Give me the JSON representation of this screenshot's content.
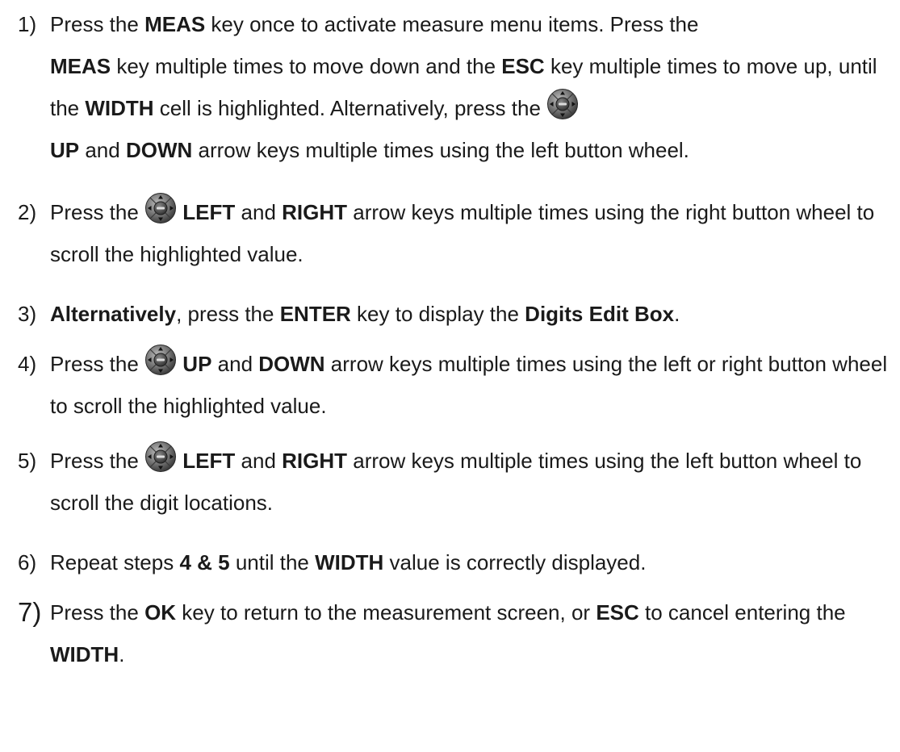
{
  "icons": {
    "wheel": "arrow-button-wheel-icon"
  },
  "steps": [
    {
      "num": "1)",
      "p1": "Press the ",
      "b1": "MEAS",
      "p2": " key once to activate measure menu items.  Press the ",
      "b2": "MEAS",
      "p3": " key multiple times to move down and the ",
      "b3": "ESC",
      "p4": " key multiple times to move up, until the ",
      "b4": "WIDTH",
      "p5": " cell is highlighted.   Alternatively, press the ",
      "b5": "UP",
      "p6": " and ",
      "b6": "DOWN",
      "p7": " arrow keys multiple times using the left button wheel."
    },
    {
      "num": "2)",
      "p1": "Press the ",
      "b1": "LEFT",
      "p2": " and ",
      "b2": "RIGHT",
      "p3": " arrow keys multiple times using the right button wheel to scroll the highlighted value."
    },
    {
      "num": "3)",
      "b1": "Alternatively",
      "p1": ", press the ",
      "b2": "ENTER",
      "p2": " key to display the ",
      "b3": "Digits Edit Box",
      "p3": "."
    },
    {
      "num": "4)",
      "p1": "Press the ",
      "b1": "UP",
      "p2": " and ",
      "b2": "DOWN",
      "p3": " arrow keys multiple times using the left or right button wheel to scroll the highlighted value."
    },
    {
      "num": "5)",
      "p1": "Press the ",
      "b1": "LEFT",
      "p2": " and ",
      "b2": "RIGHT",
      "p3": " arrow keys multiple times using the left button wheel to scroll the digit locations."
    },
    {
      "num": "6)",
      "p1": "Repeat steps ",
      "b1": "4 & 5",
      "p2": " until the ",
      "b2": "WIDTH",
      "p3": " value is correctly displayed."
    },
    {
      "num": "7)",
      "p1": "Press the ",
      "b1": "OK",
      "p2": " key to return to the measurement screen, or ",
      "b2": "ESC",
      "p3": " to cancel entering the ",
      "b3": "WIDTH",
      "p4": "."
    }
  ]
}
